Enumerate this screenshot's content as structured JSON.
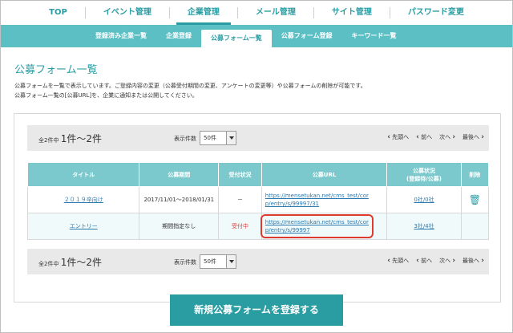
{
  "topnav": {
    "items": [
      "TOP",
      "イベント管理",
      "企業管理",
      "メール管理",
      "サイト管理",
      "パスワード変更"
    ]
  },
  "subnav": {
    "items": [
      "登録済み企業一覧",
      "企業登録",
      "公募フォーム一覧",
      "公募フォーム登録",
      "キーワード一覧"
    ]
  },
  "page": {
    "title": "公募フォーム一覧",
    "desc1": "公募フォームを一覧で表示しています。ご登録内容の変更（公募受付期間の変更、アンケートの変更等）や公募フォームの削除が可能です。",
    "desc2": "公募フォーム一覧の[公募URL]を、企業に通知または公開してください。"
  },
  "pager": {
    "count_prefix": "全2件中",
    "count_range": "1件～2件",
    "per_page_label": "表示件数",
    "per_page_value": "50件",
    "first": "先頭へ",
    "prev": "前へ",
    "next": "次へ",
    "last": "最後へ"
  },
  "table": {
    "headers": [
      "タイトル",
      "公募期間",
      "受付状況",
      "公募URL",
      "公募状況\n(登録待/公募)",
      "削除"
    ],
    "rows": [
      {
        "title": "２０１９卒向け",
        "period": "2017/11/01～2018/01/31",
        "status": "－",
        "url1": "https://mensetukan.net/cms_test/cor",
        "url2": "p/entry/s/99997/31",
        "count": "0社/0社"
      },
      {
        "title": "エントリー",
        "period": "期間指定なし",
        "status": "受付中",
        "url1": "https://mensetukan.net/cms_test/cor",
        "url2": "p/entry/s/99997",
        "count": "3社/4社"
      }
    ]
  },
  "button": {
    "register": "新規公募フォームを登録する"
  },
  "colors": {
    "accent": "#2a9da3",
    "subnav": "#5cbfc4",
    "highlight": "#e03a2e"
  }
}
